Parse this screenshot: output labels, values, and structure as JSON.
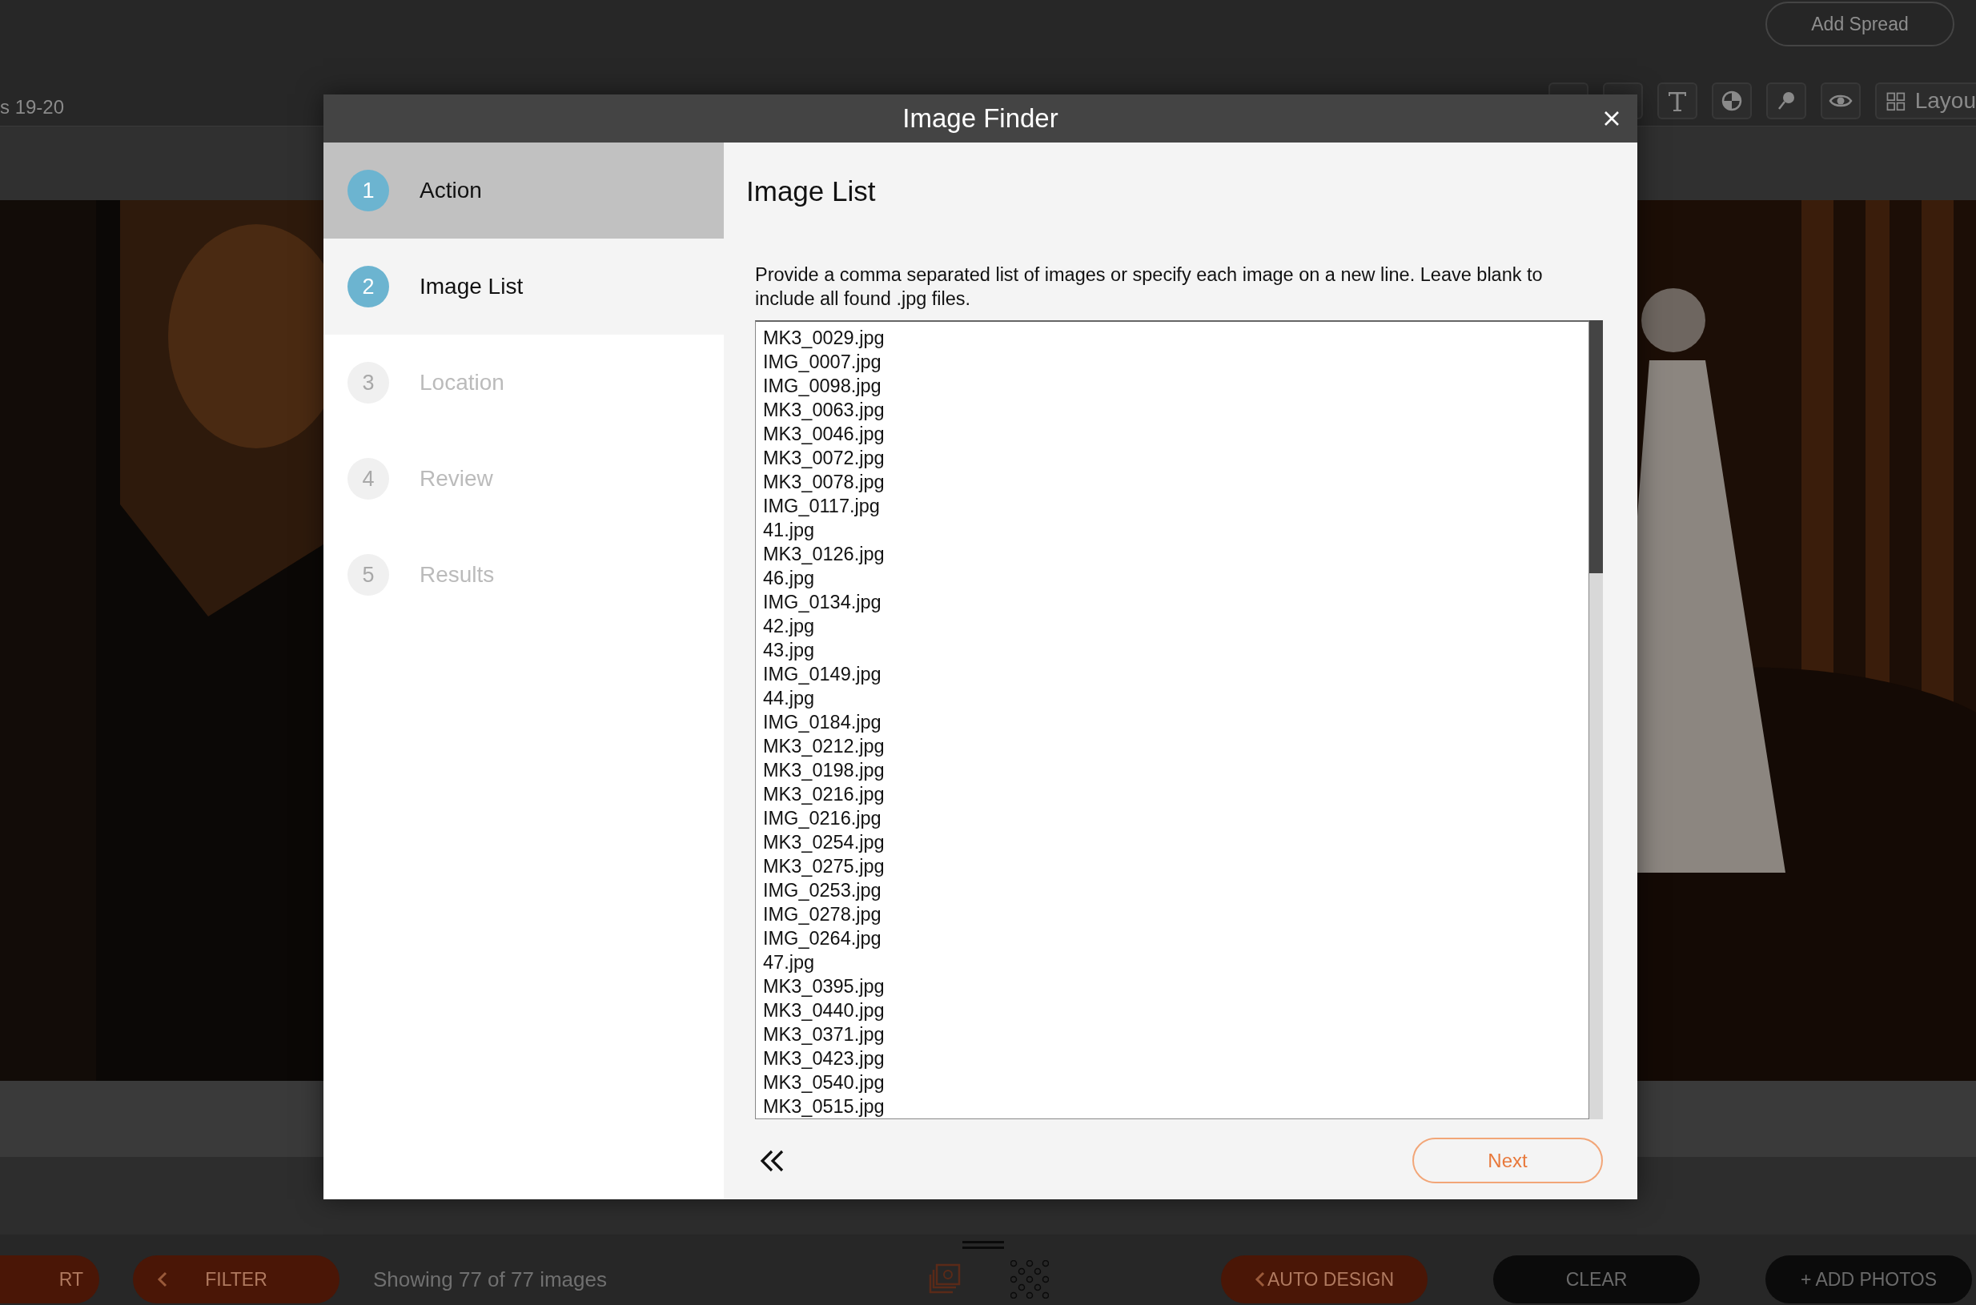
{
  "app": {
    "top_bar": {
      "add_spread_button": "Add Spread",
      "page_label": "s 19-20",
      "toolbar": [
        {
          "kind": "blank"
        },
        {
          "kind": "blank"
        },
        {
          "kind": "text"
        },
        {
          "kind": "pie"
        },
        {
          "kind": "pin"
        },
        {
          "kind": "eye"
        },
        {
          "kind": "layout",
          "label": "Layou"
        }
      ]
    },
    "bottom_bar": {
      "items": [
        {
          "kind": "accent",
          "label": "RT",
          "caret": false
        },
        {
          "kind": "accent",
          "label": "FILTER",
          "caret": true
        },
        {
          "kind": "text",
          "label": "Showing 77 of 77 images"
        },
        {
          "kind": "stack-icon"
        },
        {
          "kind": "dots-icon"
        },
        {
          "kind": "accent",
          "label": "AUTO DESIGN",
          "caret": true
        },
        {
          "kind": "dark",
          "label": "CLEAR"
        },
        {
          "kind": "dark",
          "label": "+ ADD PHOTOS"
        }
      ]
    }
  },
  "dialog": {
    "title": "Image Finder",
    "steps": [
      {
        "number": "1",
        "label": "Action",
        "selected": true,
        "disabled": false
      },
      {
        "number": "2",
        "label": "Image List",
        "selected": false,
        "disabled": false
      },
      {
        "number": "3",
        "label": "Location",
        "selected": false,
        "disabled": true
      },
      {
        "number": "4",
        "label": "Review",
        "selected": false,
        "disabled": true
      },
      {
        "number": "5",
        "label": "Results",
        "selected": false,
        "disabled": true
      }
    ],
    "heading": "Image List",
    "description": "Provide a comma separated list of images or specify each image on a new line.  Leave blank to include all found .jpg files.",
    "image_list": {
      "value": [
        "MK3_0029.jpg",
        "IMG_0007.jpg",
        "IMG_0098.jpg",
        "MK3_0063.jpg",
        "MK3_0046.jpg",
        "MK3_0072.jpg",
        "MK3_0078.jpg",
        "IMG_0117.jpg",
        "41.jpg",
        "MK3_0126.jpg",
        "46.jpg",
        "IMG_0134.jpg",
        "42.jpg",
        "43.jpg",
        "IMG_0149.jpg",
        "44.jpg",
        "IMG_0184.jpg",
        "MK3_0212.jpg",
        "MK3_0198.jpg",
        "MK3_0216.jpg",
        "IMG_0216.jpg",
        "MK3_0254.jpg",
        "MK3_0275.jpg",
        "IMG_0253.jpg",
        "IMG_0278.jpg",
        "IMG_0264.jpg",
        "47.jpg",
        "MK3_0395.jpg",
        "MK3_0440.jpg",
        "MK3_0371.jpg",
        "MK3_0423.jpg",
        "MK3_0540.jpg",
        "MK3_0515.jpg"
      ]
    },
    "next_button": "Next"
  }
}
